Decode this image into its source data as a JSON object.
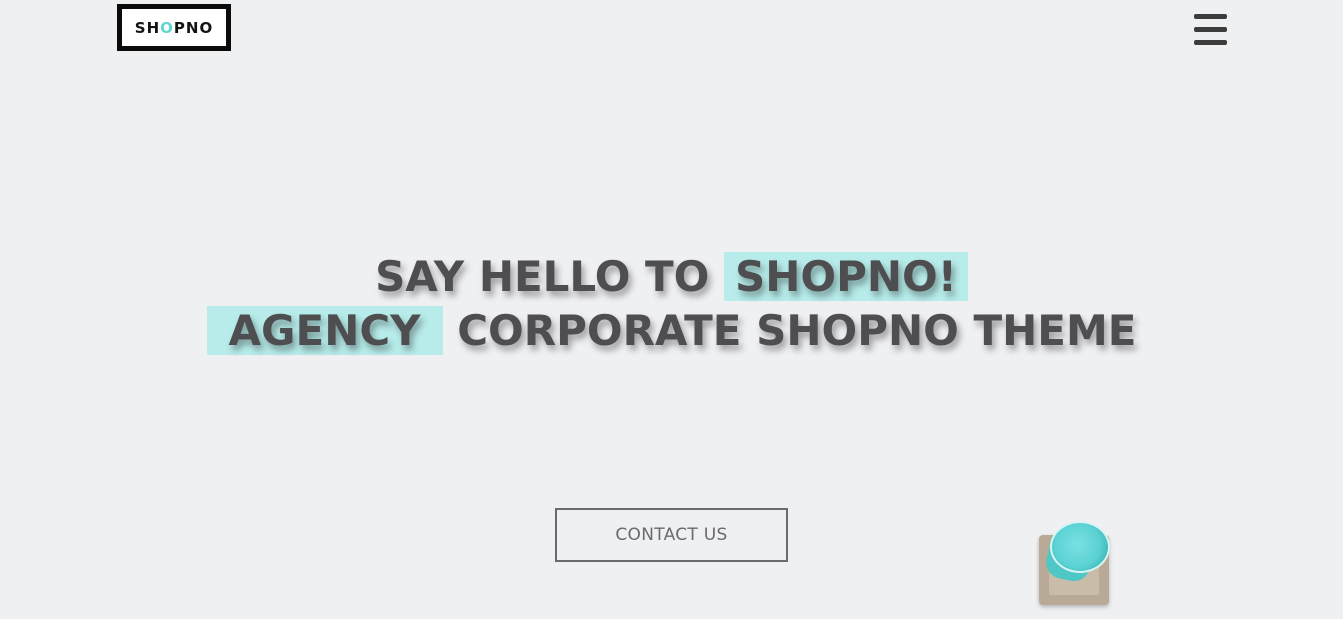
{
  "header": {
    "logo": {
      "text_before": "SH",
      "text_o": "O",
      "text_after": "PNO"
    },
    "menu_icon": "hamburger-menu-icon"
  },
  "hero": {
    "line1_part1": "SAY HELLO TO",
    "line1_highlight": "SHOPNO!",
    "line2_highlight": "AGENCY",
    "line2_part2": "CORPORATE SHOPNO THEME",
    "contact_button": "CONTACT US"
  },
  "colors": {
    "background": "#eff0f2",
    "highlight": "#b7ecea",
    "heading_text": "#4e4e50",
    "accent": "#5ed6d2"
  },
  "decoration": {
    "image": "teal-drink-glass-on-coaster"
  }
}
